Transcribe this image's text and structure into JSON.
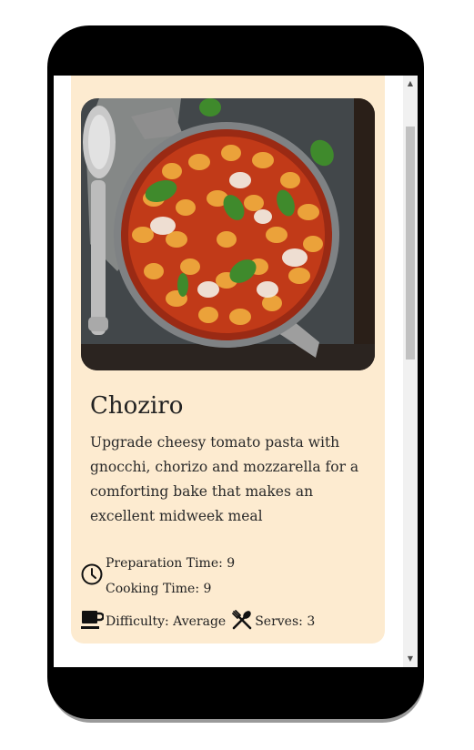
{
  "recipe": {
    "title": "Choziro",
    "description": "Upgrade cheesy tomato pasta with gnocchi, chorizo and mozzarella for a comforting bake that makes an excellent midweek meal",
    "preparation": {
      "label": "Preparation Time:",
      "value": "9"
    },
    "cooking": {
      "label": "Cooking Time:",
      "value": "9"
    },
    "difficulty": {
      "label": "Difficulty:",
      "value": "Average"
    },
    "serves": {
      "label": "Serves:",
      "value": "3"
    },
    "photo_icon": "gnocchi-bake-photo"
  },
  "icons": {
    "clock": "clock-icon",
    "difficulty": "coffee-cup-icon",
    "serves": "spoon-fork-icon"
  },
  "colors": {
    "card_background": "#fdebd0",
    "phone_frame": "#000000",
    "page_background": "#ffffff"
  }
}
